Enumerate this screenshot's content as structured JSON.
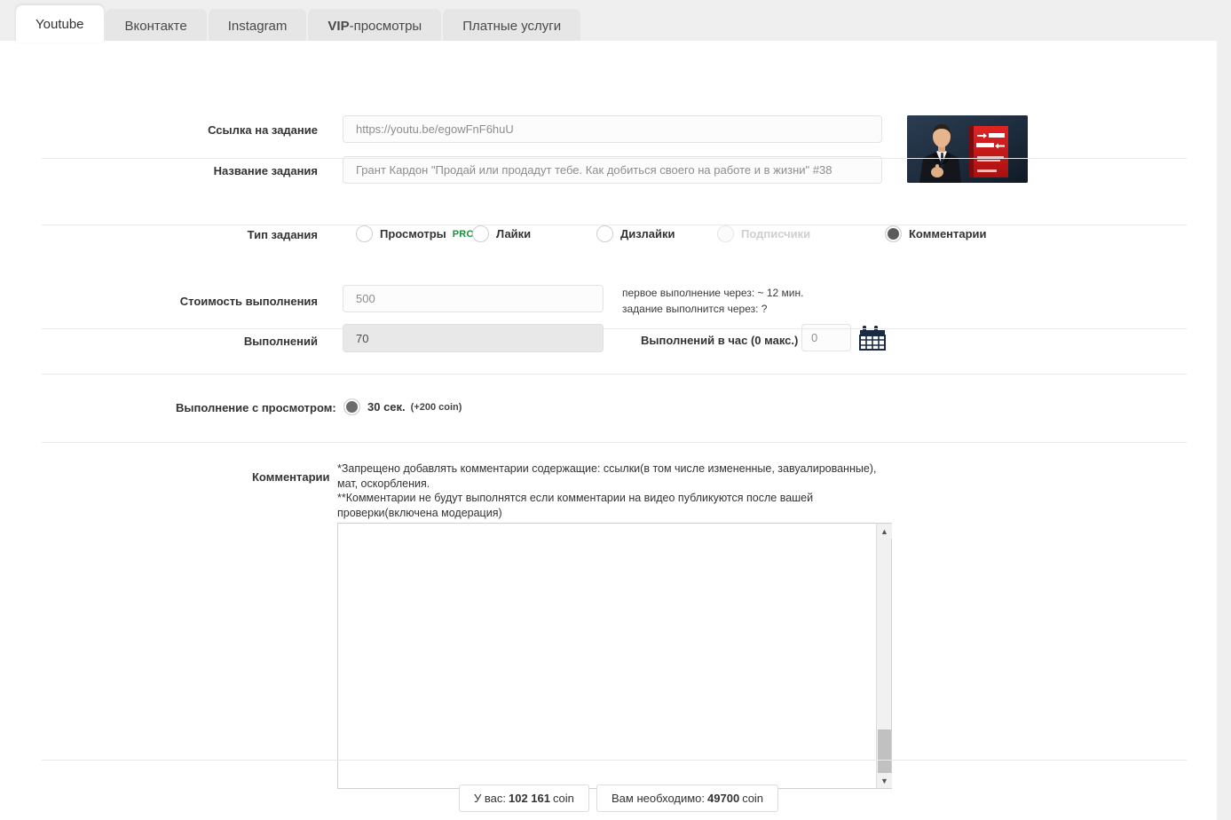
{
  "tabs": [
    {
      "label": "Youtube",
      "active": true
    },
    {
      "label": "Вконтакте",
      "active": false
    },
    {
      "label": "Instagram",
      "active": false
    },
    {
      "label": "VIP-просмотры",
      "active": false,
      "bold_prefix": "VIP"
    },
    {
      "label": "Платные услуги",
      "active": false
    }
  ],
  "form": {
    "link_label": "Ссылка на задание",
    "link_value": "https://youtu.be/egowFnF6huU",
    "title_label": "Название задания",
    "title_value": "Грант Кардон \"Продай или продадут тебе. Как добиться своего на работе и в жизни\" #38",
    "thumbnail_name": "video-thumbnail"
  },
  "task_type": {
    "label": "Тип задания",
    "options": [
      {
        "id": "views",
        "label": "Просмотры",
        "badge": "PRO",
        "checked": false,
        "disabled": false
      },
      {
        "id": "likes",
        "label": "Лайки",
        "checked": false,
        "disabled": false
      },
      {
        "id": "dislikes",
        "label": "Дизлайки",
        "checked": false,
        "disabled": false
      },
      {
        "id": "subscribers",
        "label": "Подписчики",
        "checked": false,
        "disabled": true
      },
      {
        "id": "comments",
        "label": "Комментарии",
        "checked": true,
        "disabled": false
      }
    ]
  },
  "cost": {
    "cost_label": "Стоимость выполнения",
    "cost_value": "500",
    "count_label": "Выполнений",
    "count_value": "70",
    "note_first": "первое выполнение через: ~ 12 мин.",
    "note_second": "задание выполнится через: ?",
    "per_hour_label": "Выполнений в час (0 макс.)",
    "per_hour_value": "0",
    "calendar_icon": "calendar-icon"
  },
  "watch": {
    "label": "Выполнение с просмотром:",
    "option_label": "30 сек.",
    "option_bonus": "(+200 coin)",
    "checked": true
  },
  "comments": {
    "label": "Комментарии",
    "warning_line1": "*Запрещено добавлять комментарии содержащие: ссылки(в том числе измененные, завуалированные),",
    "warning_line2": "мат, оскорбления.",
    "warning_line3": "**Комментарии не будут выполнятся если комментарии на видео публикуются после вашей",
    "warning_line4": "проверки(включена модерация)",
    "textarea_value": "",
    "textarea_placeholder": ""
  },
  "footer": {
    "balance_prefix": "У вас:",
    "balance_amount": "102 161",
    "balance_suffix": "coin",
    "required_prefix": "Вам необходимо:",
    "required_amount": "49700",
    "required_suffix": "coin"
  },
  "colors": {
    "accent_green": "#1a8f3c",
    "panel_bg": "#ffffff",
    "page_bg": "#efefef",
    "radio_checked": "#6b6b6b"
  }
}
